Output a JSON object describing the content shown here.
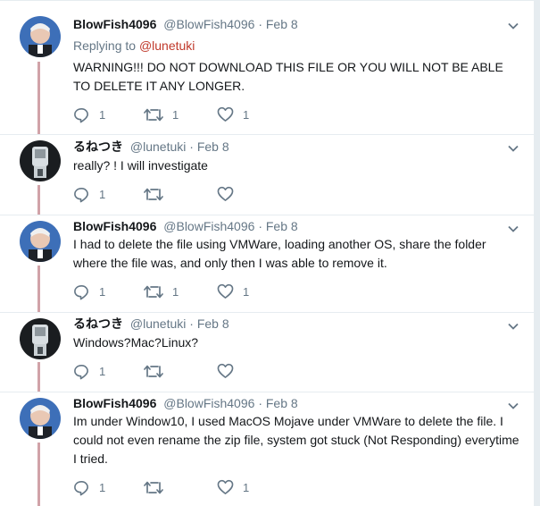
{
  "tweets": [
    {
      "name": "BlowFish4096",
      "handle": "@BlowFish4096",
      "dot": "·",
      "date": "Feb 8",
      "reply_prefix": "Replying to ",
      "reply_mention": "@lunetuki",
      "text": "WARNING!!! DO NOT DOWNLOAD THIS FILE OR YOU WILL NOT BE ABLE TO DELETE IT ANY LONGER.",
      "replies": "1",
      "retweets": "1",
      "likes": "1"
    },
    {
      "name": "るねつき",
      "handle": "@lunetuki",
      "dot": "·",
      "date": "Feb 8",
      "text": "really? ! I will investigate",
      "replies": "1",
      "retweets": "",
      "likes": ""
    },
    {
      "name": "BlowFish4096",
      "handle": "@BlowFish4096",
      "dot": "·",
      "date": "Feb 8",
      "text": "I had to delete the file using VMWare, loading another OS, share the folder where the file was, and only then I was able to remove it.",
      "replies": "1",
      "retweets": "1",
      "likes": "1"
    },
    {
      "name": "るねつき",
      "handle": "@lunetuki",
      "dot": "·",
      "date": "Feb 8",
      "text": "Windows?Mac?Linux?",
      "replies": "1",
      "retweets": "",
      "likes": ""
    },
    {
      "name": "BlowFish4096",
      "handle": "@BlowFish4096",
      "dot": "·",
      "date": "Feb 8",
      "text": "Im under Window10, I used MacOS Mojave under VMWare to delete the file. I could not even rename the zip file, system got stuck (Not Responding) everytime I tried.",
      "replies": "1",
      "retweets": "",
      "likes": "1"
    }
  ],
  "colors": {
    "thread_line": "#d1a3a8",
    "mention": "#c0392b",
    "muted": "#657786"
  },
  "icons": [
    "chevron-down-icon",
    "reply-icon",
    "retweet-icon",
    "like-icon"
  ]
}
